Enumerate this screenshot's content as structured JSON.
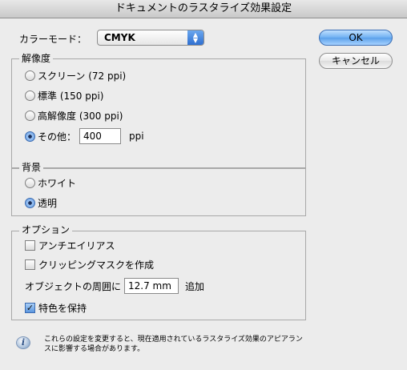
{
  "window": {
    "title": "ドキュメントのラスタライズ効果設定"
  },
  "color_mode": {
    "label": "カラーモード：",
    "value": "CMYK"
  },
  "buttons": {
    "ok": "OK",
    "cancel": "キャンセル"
  },
  "resolution": {
    "title": "解像度",
    "options": [
      {
        "label": "スクリーン (72 ppi)",
        "selected": false
      },
      {
        "label": "標準 (150 ppi)",
        "selected": false
      },
      {
        "label": "高解像度 (300 ppi)",
        "selected": false
      },
      {
        "label": "その他：",
        "selected": true
      }
    ],
    "other_value": "400",
    "unit": "ppi"
  },
  "background": {
    "title": "背景",
    "options": [
      {
        "label": "ホワイト",
        "selected": false
      },
      {
        "label": "透明",
        "selected": true
      }
    ]
  },
  "options": {
    "title": "オプション",
    "antialias": {
      "label": "アンチエイリアス",
      "checked": false
    },
    "clipping_mask": {
      "label": "クリッピングマスクを作成",
      "checked": false
    },
    "around_object": {
      "label": "オブジェクトの周囲に",
      "value": "12.7 mm",
      "suffix": "追加"
    },
    "preserve_spot": {
      "label": "特色を保持",
      "checked": true
    }
  },
  "info": {
    "text_line1": "これらの設定を変更すると、現在適用されているラスタライズ効果のアピアラン",
    "text_line2": "スに影響する場合があります。"
  }
}
